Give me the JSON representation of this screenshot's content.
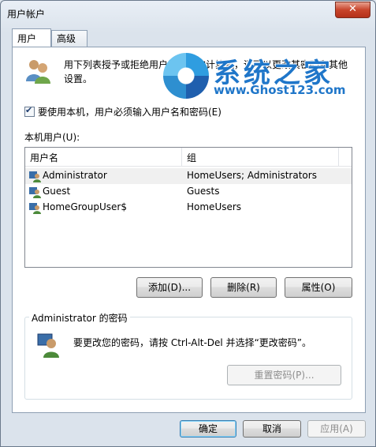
{
  "window": {
    "title": "用户帐户",
    "close_label": "✕"
  },
  "tabs": [
    {
      "label": "用户"
    },
    {
      "label": "高级"
    }
  ],
  "intro": {
    "text": "用下列表授予或拒绝用户访问您的计算机，还可以更改其密码和其他设置。"
  },
  "checkbox": {
    "label": "要使用本机，用户必须输入用户名和密码(E)",
    "checked": true
  },
  "local_users": {
    "label": "本机用户(U):",
    "columns": [
      "用户名",
      "组"
    ],
    "rows": [
      {
        "name": "Administrator",
        "group": "HomeUsers; Administrators",
        "selected": true
      },
      {
        "name": "Guest",
        "group": "Guests",
        "selected": false
      },
      {
        "name": "HomeGroupUser$",
        "group": "HomeUsers",
        "selected": false
      }
    ]
  },
  "user_buttons": {
    "add": "添加(D)...",
    "remove": "删除(R)",
    "properties": "属性(O)"
  },
  "password_group": {
    "title": "Administrator 的密码",
    "text": "要更改您的密码，请按 Ctrl-Alt-Del 并选择“更改密码”。",
    "reset_button": "重置密码(P)..."
  },
  "dialog_buttons": {
    "ok": "确定",
    "cancel": "取消",
    "apply": "应用(A)"
  },
  "watermark": {
    "title": "系统之家",
    "url": "www.Ghost123.com"
  },
  "icons": {
    "users": "users-icon",
    "user": "user-icon",
    "password_user": "user-password-icon"
  }
}
